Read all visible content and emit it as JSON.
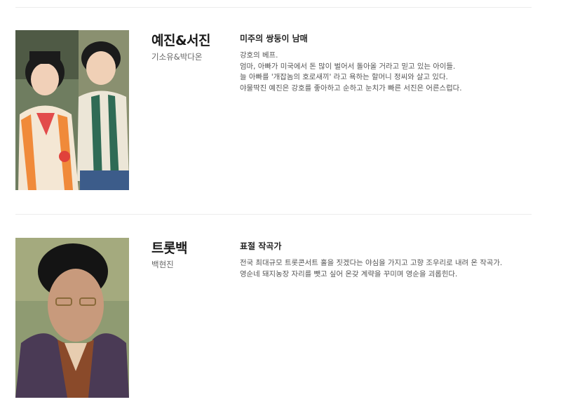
{
  "characters": [
    {
      "name": "예진&서진",
      "actor": "기소유&박다온",
      "role": "미주의 쌍둥이 남매",
      "description": [
        "강호의 베프.",
        "엄마, 아빠가 미국에서 돈 많이 벌어서 돌아올 거라고 믿고 있는 아이들.",
        "늘 아빠를 '개잡놈의 호로새끼' 라고 욕하는 할머니 정씨와 살고 있다.",
        "야물딱진 예진은 강호를 좋아하고 순하고 눈치가 빠른 서진은 어른스럽다."
      ]
    },
    {
      "name": "트롯백",
      "actor": "백현진",
      "role": "표절 작곡가",
      "description": [
        "전국 최대규모 트롯콘서트 홀을 짓겠다는 야심을 가지고 고향 조우리로 내려 온 작곡가.",
        "영순네 돼지농장 자리를 뺏고 싶어 온갖 계략을 꾸미며 영순을 괴롭힌다."
      ]
    }
  ],
  "colors": {
    "divider": "#ececec",
    "name": "#1a1a1a",
    "text": "#555555"
  },
  "icons": [
    "twins-portrait-photo",
    "man-portrait-photo"
  ]
}
